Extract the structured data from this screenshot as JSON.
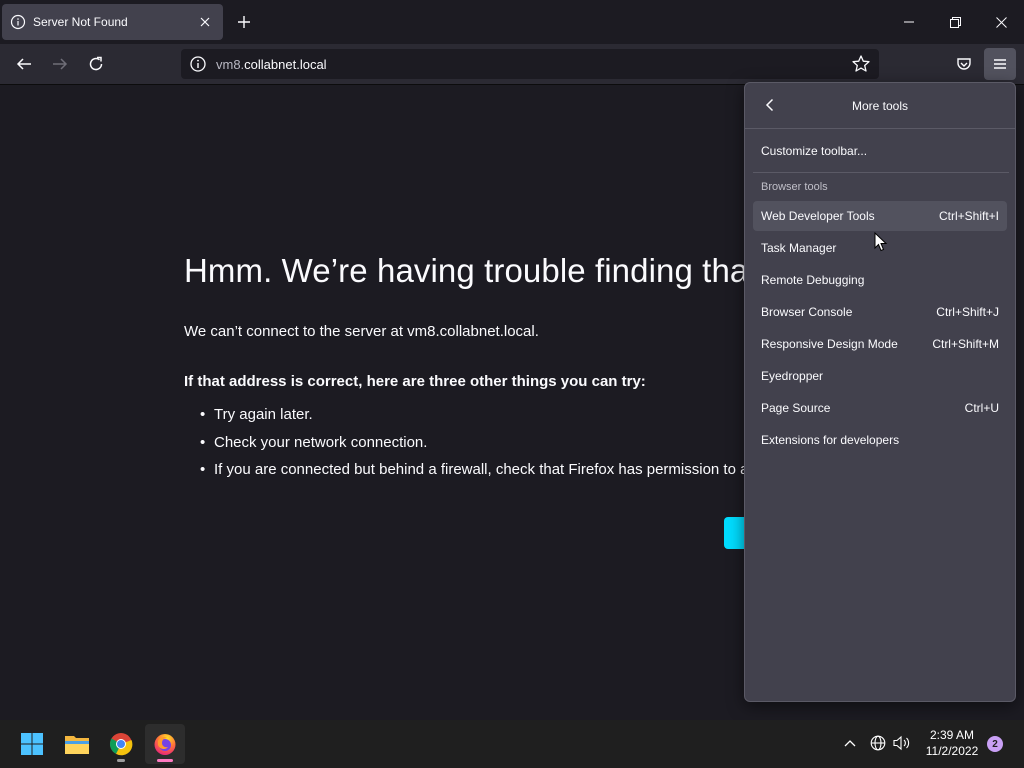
{
  "tab": {
    "title": "Server Not Found"
  },
  "urlbar": {
    "host_prefix": "vm8.",
    "host_main": "collabnet.local"
  },
  "error": {
    "title": "Hmm. We’re having trouble finding that s",
    "description": "We can’t connect to the server at vm8.collabnet.local.",
    "subheading": "If that address is correct, here are three other things you can try:",
    "tips": [
      "Try again later.",
      "Check your network connection.",
      "If you are connected but behind a firewall, check that Firefox has permission to a"
    ]
  },
  "panel": {
    "title": "More tools",
    "customize": "Customize toolbar...",
    "section_label": "Browser tools",
    "items": [
      {
        "label": "Web Developer Tools",
        "shortcut": "Ctrl+Shift+I"
      },
      {
        "label": "Task Manager",
        "shortcut": ""
      },
      {
        "label": "Remote Debugging",
        "shortcut": ""
      },
      {
        "label": "Browser Console",
        "shortcut": "Ctrl+Shift+J"
      },
      {
        "label": "Responsive Design Mode",
        "shortcut": "Ctrl+Shift+M"
      },
      {
        "label": "Eyedropper",
        "shortcut": ""
      },
      {
        "label": "Page Source",
        "shortcut": "Ctrl+U"
      },
      {
        "label": "Extensions for developers",
        "shortcut": ""
      }
    ]
  },
  "taskbar": {
    "time": "2:39 AM",
    "date": "11/2/2022",
    "notification_count": "2",
    "apps": [
      "start-icon",
      "file-explorer-icon",
      "chrome-icon",
      "firefox-icon"
    ]
  },
  "colors": {
    "accent": "#00ddff",
    "page_bg": "#1c1b22",
    "panel_bg": "#42414d"
  }
}
